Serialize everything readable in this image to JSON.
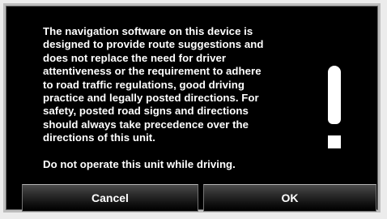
{
  "dialog": {
    "message_paragraph_1_lines": [
      "The navigation software on this device is",
      "designed to provide route suggestions and",
      "does not replace the need for driver",
      "attentiveness or the requirement to adhere",
      "to road traffic regulations, good driving",
      "practice and legally posted directions.  For",
      "safety, posted road signs and directions",
      "should always take precedence over the",
      "directions of this unit."
    ],
    "message_paragraph_2": "Do not operate this unit while driving.",
    "warning_icon": "exclamation-icon"
  },
  "buttons": {
    "cancel_label": "Cancel",
    "ok_label": "OK"
  },
  "colors": {
    "dialog_background": "#000000",
    "text": "#ffffff",
    "dialog_border": "#bdbdbd"
  }
}
